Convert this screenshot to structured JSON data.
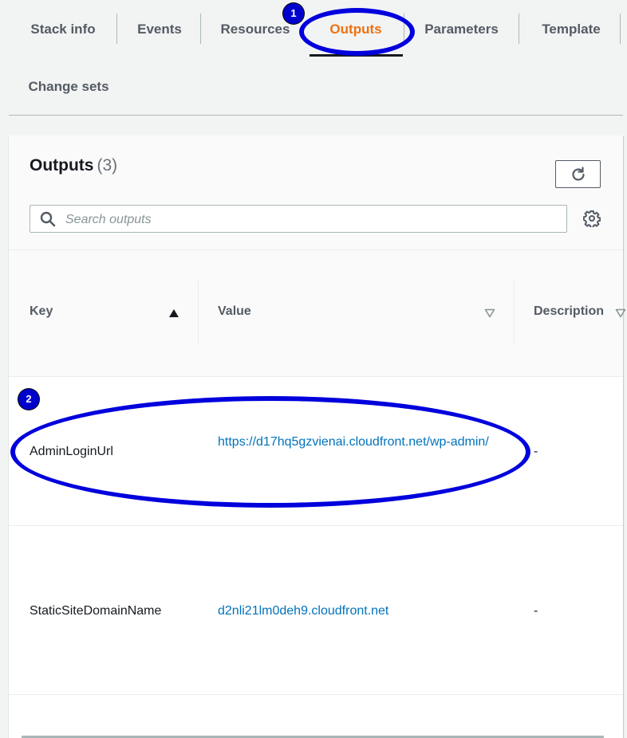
{
  "tabs": [
    {
      "label": "Stack info"
    },
    {
      "label": "Events"
    },
    {
      "label": "Resources"
    },
    {
      "label": "Outputs",
      "active": true
    },
    {
      "label": "Parameters"
    },
    {
      "label": "Template"
    },
    {
      "label": "Change sets"
    }
  ],
  "outputs": {
    "title": "Outputs",
    "count": "(3)",
    "search_placeholder": "Search outputs",
    "columns": {
      "key": "Key",
      "value": "Value",
      "description": "Description"
    },
    "rows": [
      {
        "key": "AdminLoginUrl",
        "value": "https://d17hq5gzvienai.cloudfront.net/wp-admin/",
        "description": "-"
      },
      {
        "key": "StaticSiteDomainName",
        "value": "d2nli21lm0deh9.cloudfront.net",
        "description": "-"
      }
    ]
  },
  "annotations": {
    "step1": "1",
    "step2": "2"
  },
  "colors": {
    "active_tab": "#ec7211",
    "link": "#0073bb",
    "annotation": "#0000dd"
  }
}
